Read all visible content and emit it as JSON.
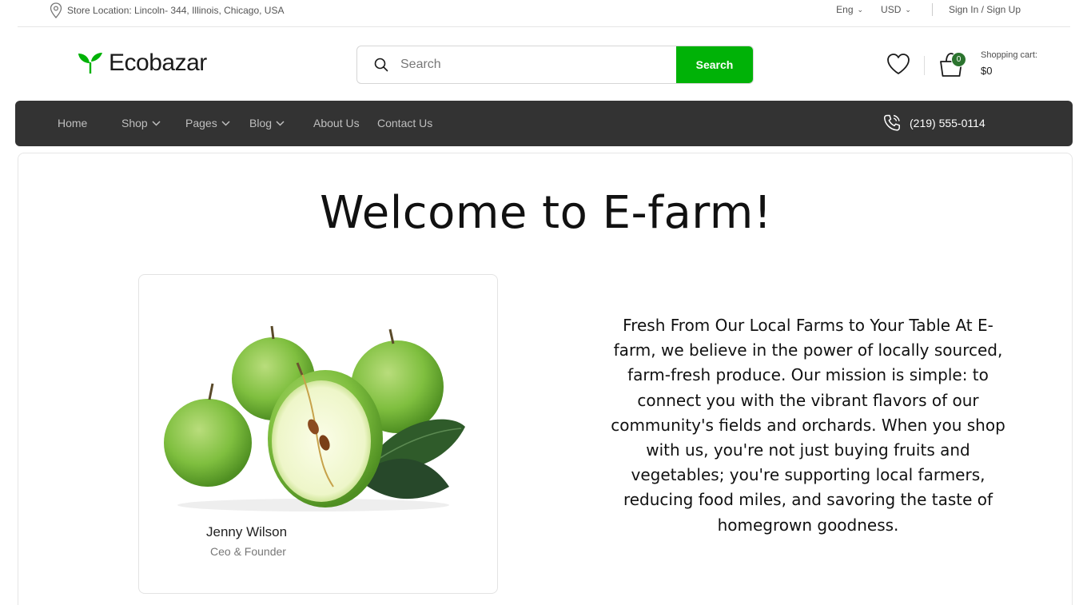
{
  "topbar": {
    "store_location": "Store Location: Lincoln- 344, Illinois, Chicago, USA",
    "language": "Eng",
    "currency": "USD",
    "auth": "Sign In / Sign Up"
  },
  "header": {
    "logo_text": "Ecobazar",
    "search_placeholder": "Search",
    "search_button": "Search",
    "cart_count": "0",
    "cart_label": "Shopping cart:",
    "cart_total": "$0"
  },
  "nav": {
    "items": [
      {
        "label": "Home"
      },
      {
        "label": "Shop"
      },
      {
        "label": "Pages"
      },
      {
        "label": "Blog"
      },
      {
        "label": "About Us"
      },
      {
        "label": "Contact Us"
      }
    ],
    "phone": "(219) 555-0114"
  },
  "main": {
    "heading": "Welcome to E-farm!",
    "person_name": "Jenny Wilson",
    "person_role": "Ceo & Founder",
    "intro": "Fresh From Our Local Farms to Your Table At E-farm, we believe in the power of locally sourced, farm-fresh produce. Our mission is simple: to connect you with the vibrant flavors of our community's fields and orchards. When you shop with us, you're not just buying fruits and vegetables; you're supporting local farmers, reducing food miles, and savoring the taste of homegrown goodness."
  },
  "colors": {
    "brand_green": "#00b207",
    "dark_green": "#2c742f",
    "nav_bg": "#333333"
  }
}
